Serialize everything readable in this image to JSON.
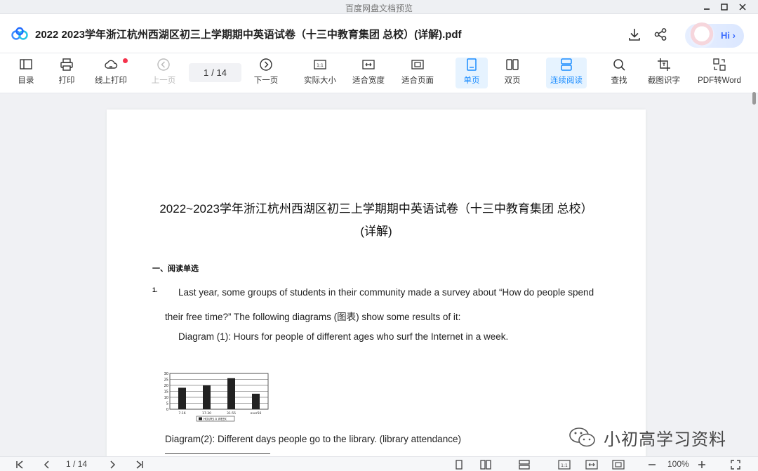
{
  "window": {
    "title": "百度网盘文档预览"
  },
  "file": {
    "name": "2022 2023学年浙江杭州西湖区初三上学期期中英语试卷（十三中教育集团 总校）(详解).pdf"
  },
  "assistant": {
    "label": "Hi"
  },
  "toolbar": {
    "catalog": "目录",
    "print": "打印",
    "online_print": "线上打印",
    "prev": "上一页",
    "page_current": "1",
    "page_total": "/ 14",
    "next": "下一页",
    "actual_size": "实际大小",
    "fit_width": "适合宽度",
    "fit_page": "适合页面",
    "single": "单页",
    "double": "双页",
    "continuous": "连续阅读",
    "find": "查找",
    "ocr": "截图识字",
    "pdf_to_word": "PDF转Word",
    "actual_size_glyph": "1:1"
  },
  "document": {
    "title_line1": "2022~2023学年浙江杭州西湖区初三上学期期中英语试卷（十三中教育集团 总校）",
    "title_line2": "(详解)",
    "section": "一、阅读单选",
    "q_number": "1.",
    "para1_line1": "Last year, some groups of students in their community made a survey about “How do people spend",
    "para1_line2": "their free time?” The following diagrams (图表) show some results of it:",
    "diagram1": "Diagram (1): Hours for people of different ages who surf the Internet in a week.",
    "diagram2": "Diagram(2): Different days people go to the library. (library attendance)"
  },
  "chart_data": {
    "type": "bar",
    "categories": [
      "7-16",
      "17-30",
      "31-55",
      "over56"
    ],
    "values": [
      18,
      20,
      26,
      13
    ],
    "ylim": [
      0,
      30
    ],
    "yticks": [
      "0",
      "5",
      "10",
      "15",
      "20",
      "25",
      "30"
    ],
    "legend": "HOURS A WEEK",
    "grid": true,
    "bar_color": "#222222"
  },
  "watermark": {
    "text": "小初高学习资料"
  },
  "bottom": {
    "page_current": "1",
    "page_total": "/ 14",
    "zoom": "100%",
    "actual_size_glyph": "1:1"
  },
  "colors": {
    "accent": "#1a8cff",
    "active_bg": "#e6f3ff",
    "notify": "#f5324c"
  }
}
